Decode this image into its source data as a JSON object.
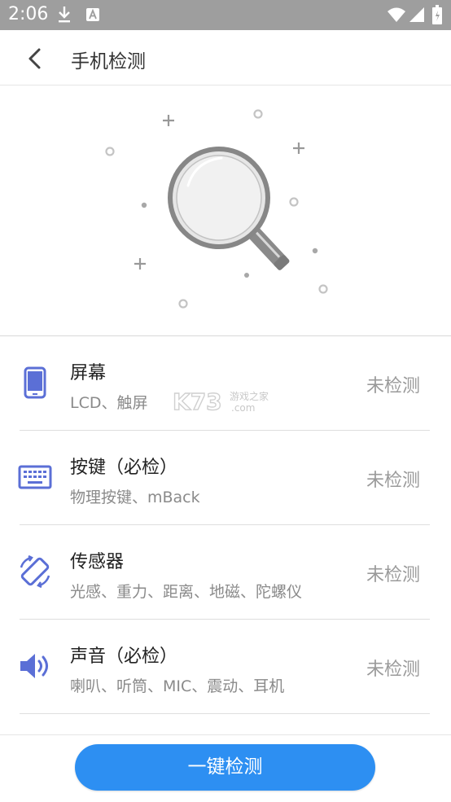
{
  "status_bar": {
    "time": "2:06",
    "icons": [
      "download-icon",
      "a-badge-icon",
      "wifi-icon",
      "cell-signal-icon",
      "battery-icon"
    ]
  },
  "app_bar": {
    "back_icon": "back-arrow-icon",
    "title": "手机检测"
  },
  "hero": {
    "icon": "magnifier-icon"
  },
  "items": [
    {
      "name": "屏幕",
      "sub": "LCD、触屏",
      "status": "未检测",
      "icon": "phone-icon"
    },
    {
      "name": "按键（必检）",
      "sub": "物理按键、mBack",
      "status": "未检测",
      "icon": "keyboard-icon"
    },
    {
      "name": "传感器",
      "sub": "光感、重力、距离、地磁、陀螺仪",
      "status": "未检测",
      "icon": "rotate-sensor-icon"
    },
    {
      "name": "声音（必检）",
      "sub": "喇叭、听筒、MIC、震动、耳机",
      "status": "未检测",
      "icon": "speaker-icon"
    }
  ],
  "watermark": {
    "brand": "K73",
    "tagline": "游戏之家",
    "domain": ".com"
  },
  "bottom": {
    "button_label": "一键检测"
  },
  "colors": {
    "accent": "#2d8ff2",
    "icon": "#5b6fd6",
    "status_bar": "#9e9e9e"
  }
}
